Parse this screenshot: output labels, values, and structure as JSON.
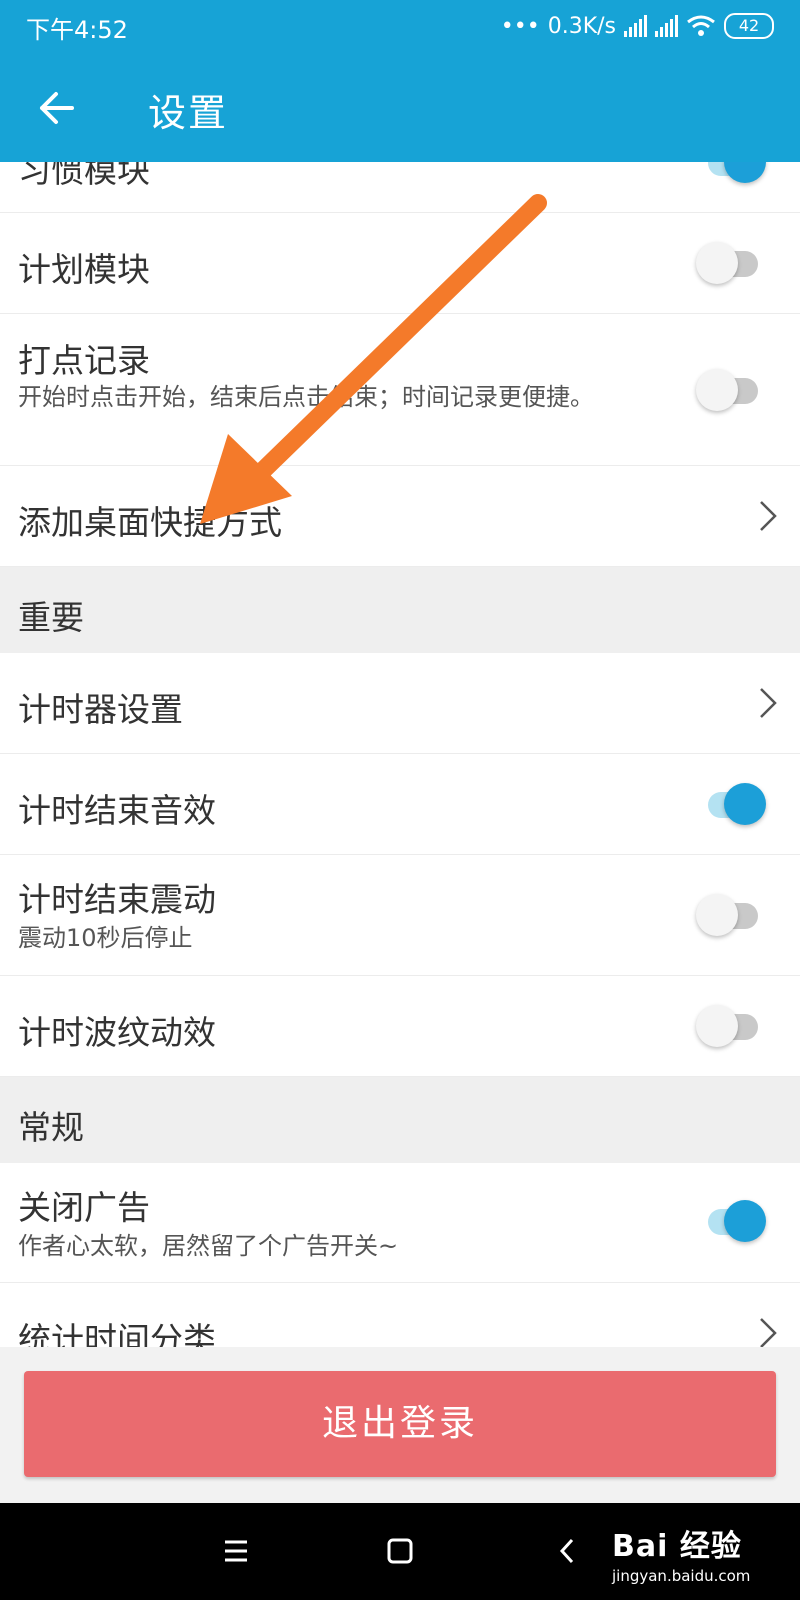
{
  "status_bar": {
    "time": "下午4:52",
    "net_speed": "0.3K/s",
    "battery": "42"
  },
  "app_bar": {
    "title": "设置"
  },
  "items_top": [
    {
      "title": "习惯模块",
      "toggle": true
    },
    {
      "title": "计划模块",
      "toggle": false
    },
    {
      "title": "打点记录",
      "subtitle": "开始时点击开始，结束后点击结束；时间记录更便捷。",
      "toggle": false
    },
    {
      "title": "添加桌面快捷方式"
    }
  ],
  "sections": [
    {
      "header": "重要",
      "items": [
        {
          "title": "计时器设置"
        },
        {
          "title": "计时结束音效",
          "toggle": true
        },
        {
          "title": "计时结束震动",
          "subtitle": "震动10秒后停止",
          "toggle": false
        },
        {
          "title": "计时波纹动效",
          "toggle": false
        }
      ]
    },
    {
      "header": "常规",
      "items": [
        {
          "title": "关闭广告",
          "subtitle": "作者心太软，居然留了个广告开关~",
          "toggle": true
        },
        {
          "title": "统计时间分类"
        }
      ]
    }
  ],
  "logout_button": "退出登录",
  "watermark": {
    "main": "Bai 经验",
    "sub": "jingyan.baidu.com"
  },
  "colors": {
    "primary": "#17a3d6",
    "toggle_on": "#1c9fd8",
    "logout": "#ea6b6f",
    "annotation_arrow": "#f47a2a"
  }
}
